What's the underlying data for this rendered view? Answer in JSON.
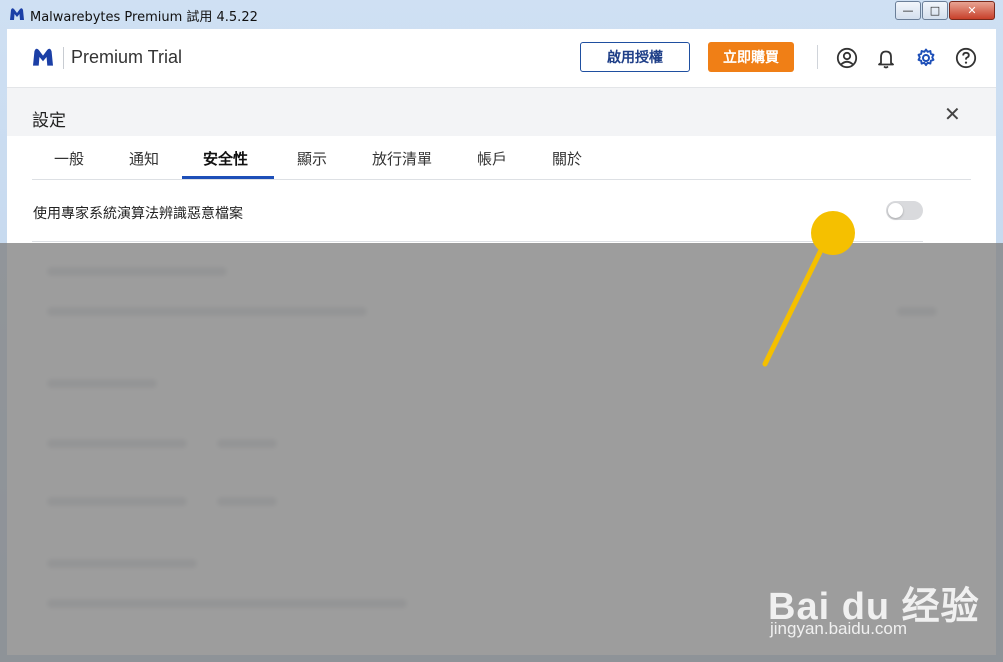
{
  "window": {
    "title": "Malwarebytes Premium 試用  4.5.22",
    "buttons": {
      "minimize": "—",
      "maximize": "□",
      "close": "✕"
    }
  },
  "header": {
    "app_name": "Premium Trial",
    "activate_label": "啟用授權",
    "buy_label": "立即購買",
    "icons": [
      "account-icon",
      "bell-icon",
      "gear-icon",
      "help-icon"
    ],
    "accent_color": "#1d4fb8",
    "buy_color": "#f07f16"
  },
  "settings": {
    "title": "設定",
    "close_glyph": "✕",
    "tabs": [
      {
        "label": "一般"
      },
      {
        "label": "通知"
      },
      {
        "label": "安全性",
        "active": true
      },
      {
        "label": "顯示"
      },
      {
        "label": "放行清單"
      },
      {
        "label": "帳戶"
      },
      {
        "label": "關於"
      }
    ],
    "rows": [
      {
        "label": "使用專家系統演算法辨識惡意檔案",
        "enabled": false
      }
    ]
  },
  "watermark": {
    "main": "Bai du 经验",
    "sub": "jingyan.baidu.com"
  },
  "annotation": {
    "pointer_color": "#f5c000"
  }
}
